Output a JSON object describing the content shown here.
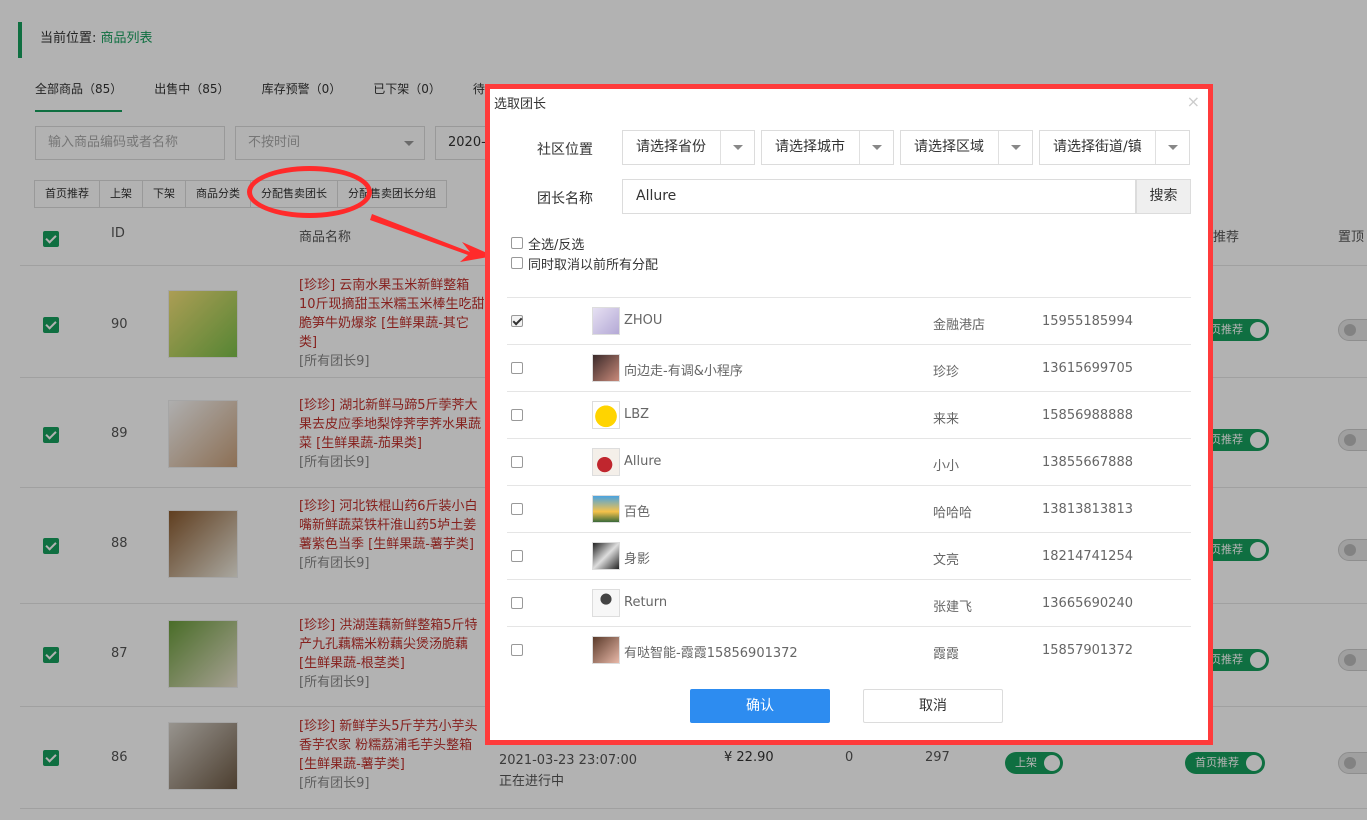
{
  "breadcrumb": {
    "prefix": "当前位置:",
    "current": "商品列表"
  },
  "tabs": [
    {
      "label": "全部商品（85）"
    },
    {
      "label": "出售中（85）"
    },
    {
      "label": "库存预警（0）"
    },
    {
      "label": "已下架（0）"
    },
    {
      "label": "待"
    }
  ],
  "filters": {
    "search_placeholder": "输入商品编码或者名称",
    "time_select": "不按时间",
    "date_value": "2020-"
  },
  "toolbar": {
    "home_recommend": "首页推荐",
    "shelve": "上架",
    "unshelve": "下架",
    "category": "商品分类",
    "assign_leader": "分配售卖团长",
    "assign_leader_group": "分配售卖团长分组"
  },
  "table_headers": {
    "id": "ID",
    "name": "商品名称",
    "recommend": "推荐",
    "top": "置顶"
  },
  "rows": [
    {
      "id": "90",
      "name": "[珍珍] 云南水果玉米新鲜整箱10斤现摘甜玉米糯玉米棒生吃甜脆笋牛奶爆浆 [生鲜果蔬-其它类]",
      "group": "[所有团长9]",
      "recommend": "首页推荐"
    },
    {
      "id": "89",
      "name": "[珍珍] 湖北新鲜马蹄5斤荸荠大果去皮应季地梨饽荠孛荠水果蔬菜 [生鲜果蔬-茄果类]",
      "group": "[所有团长9]",
      "recommend": "首页推荐"
    },
    {
      "id": "88",
      "name": "[珍珍] 河北铁棍山药6斤装小白嘴新鲜蔬菜铁杆淮山药5垆土姜薯紫色当季 [生鲜果蔬-薯芋类]",
      "group": "[所有团长9]",
      "recommend": "首页推荐"
    },
    {
      "id": "87",
      "name": "[珍珍] 洪湖莲藕新鲜整箱5斤特产九孔藕糯米粉藕尖煲汤脆藕 [生鲜果蔬-根茎类]",
      "group": "[所有团长9]",
      "recommend": "首页推荐"
    },
    {
      "id": "86",
      "name": "[珍珍] 新鲜芋头5斤芋艿小芋头香芋农家 粉糯荔浦毛芋头整箱 [生鲜果蔬-薯芋类]",
      "group": "[所有团长9]",
      "time": "2021-03-23 23:07:00",
      "status": "正在进行中",
      "price": "¥ 22.90",
      "sales": "0",
      "stock": "297",
      "shelf": "上架",
      "recommend": "首页推荐"
    }
  ],
  "dialog": {
    "title": "选取团长",
    "close": "×",
    "location_label": "社区位置",
    "province": "请选择省份",
    "city": "请选择城市",
    "district": "请选择区域",
    "street": "请选择街道/镇",
    "name_label": "团长名称",
    "name_value": "Allure",
    "search_button": "搜索",
    "select_all": "全选/反选",
    "cancel_previous": "同时取消以前所有分配",
    "leaders": [
      {
        "name": "ZHOU",
        "store": "金融港店",
        "phone": "15955185994",
        "checked": true
      },
      {
        "name": "向边走-有调&小程序",
        "store": "珍珍",
        "phone": "13615699705",
        "checked": false
      },
      {
        "name": "LBZ",
        "store": "来来",
        "phone": "15856988888",
        "checked": false
      },
      {
        "name": "Allure",
        "store": "小小",
        "phone": "13855667888",
        "checked": false
      },
      {
        "name": "百色",
        "store": "哈哈哈",
        "phone": "13813813813",
        "checked": false
      },
      {
        "name": "身影",
        "store": "文亮",
        "phone": "18214741254",
        "checked": false
      },
      {
        "name": "Return",
        "store": "张建飞",
        "phone": "13665690240",
        "checked": false
      },
      {
        "name": "有哒智能-霞霞15856901372",
        "store": "霞霞",
        "phone": "15857901372",
        "checked": false
      }
    ],
    "confirm": "确认",
    "cancel": "取消"
  },
  "colors": {
    "brand_green": "#16a05d",
    "annotation_red": "#ff3b3b",
    "primary_blue": "#2d8cf0"
  }
}
